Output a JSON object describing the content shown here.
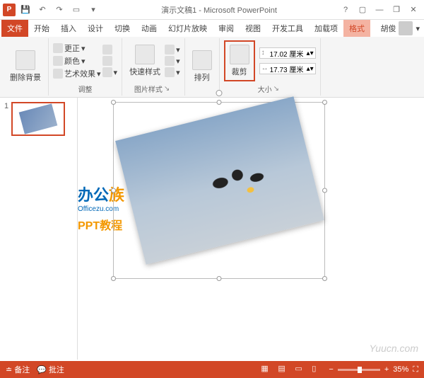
{
  "title": "演示文稿1 - Microsoft PowerPoint",
  "qat": {
    "save_icon": "save",
    "undo_icon": "undo",
    "redo_icon": "redo",
    "start_icon": "play"
  },
  "tabs": {
    "file": "文件",
    "items": [
      "开始",
      "插入",
      "设计",
      "切换",
      "动画",
      "幻灯片放映",
      "审阅",
      "视图",
      "开发工具",
      "加载项"
    ],
    "format": "格式"
  },
  "user": {
    "name": "胡俊"
  },
  "ribbon": {
    "remove_bg": {
      "label": "删除背景"
    },
    "adjust": {
      "corrections": "更正",
      "color": "颜色",
      "artistic": "艺术效果",
      "group_label": "调整"
    },
    "styles": {
      "quick_styles": "快速样式",
      "group_label": "图片样式"
    },
    "arrange": {
      "label": "排列"
    },
    "crop": {
      "label": "裁剪"
    },
    "size": {
      "height": "17.02 厘米",
      "width": "17.73 厘米",
      "group_label": "大小"
    }
  },
  "thumbs": {
    "slide1_num": "1"
  },
  "watermark": {
    "brand_cn_a": "办公",
    "brand_cn_b": "族",
    "brand_en": "Officezu.com",
    "ppt_line": "PPT教程",
    "site": "Yuucn.com"
  },
  "statusbar": {
    "notes": "备注",
    "comments": "批注",
    "zoom": "35%"
  }
}
